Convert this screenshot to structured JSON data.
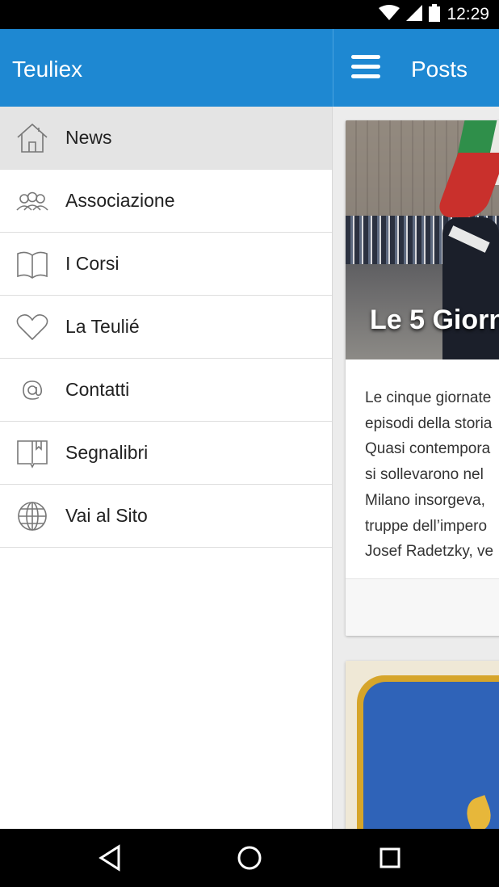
{
  "status_bar": {
    "time": "12:29",
    "icons": [
      "wifi-icon",
      "signal-icon",
      "battery-icon"
    ]
  },
  "drawer": {
    "title": "Teuliex",
    "items": [
      {
        "label": "News",
        "icon": "home-icon",
        "active": true
      },
      {
        "label": "Associazione",
        "icon": "people-icon",
        "active": false
      },
      {
        "label": "I Corsi",
        "icon": "book-icon",
        "active": false
      },
      {
        "label": "La Teulié",
        "icon": "heart-icon",
        "active": false
      },
      {
        "label": "Contatti",
        "icon": "at-icon",
        "active": false
      },
      {
        "label": "Segnalibri",
        "icon": "bookmark-icon",
        "active": false
      },
      {
        "label": "Vai al Sito",
        "icon": "globe-icon",
        "active": false
      }
    ]
  },
  "main": {
    "title": "Posts",
    "posts": [
      {
        "title": "Le 5 Giorn",
        "excerpt_lines": [
          "Le cinque giornate",
          "episodi della storia",
          "Quasi contempora",
          "si sollevarono nel",
          "Milano insorgeva,",
          "truppe dell’impero",
          "Josef Radetzky, ve"
        ]
      }
    ]
  },
  "nav_bar": {
    "buttons": [
      "back-icon",
      "home-circle-icon",
      "recents-icon"
    ]
  },
  "colors": {
    "app_bar": "#1e88d2",
    "active_item": "#e4e4e4",
    "status_bar": "#000000"
  }
}
